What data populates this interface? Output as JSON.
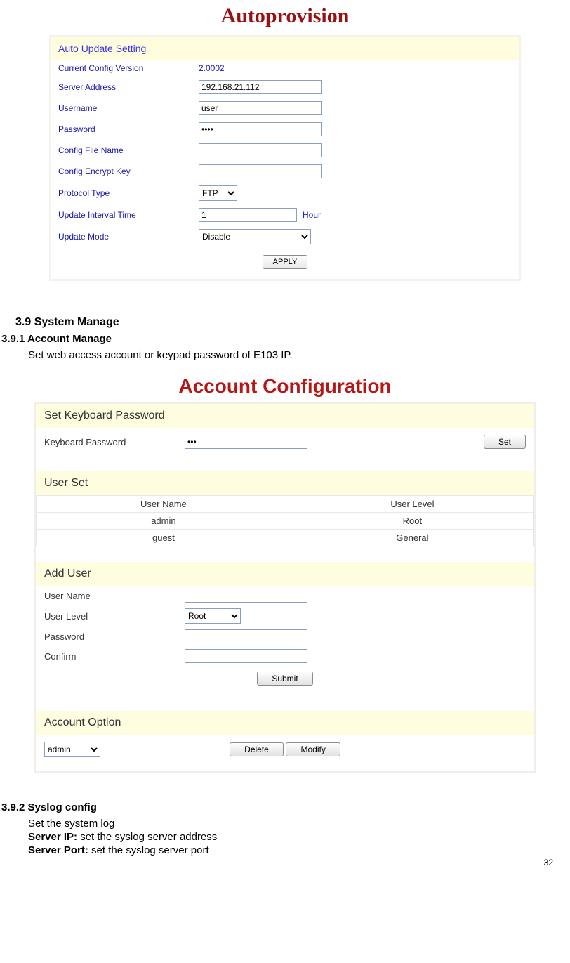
{
  "page_number": "32",
  "autoprovision": {
    "title": "Autoprovision",
    "section": "Auto Update Setting",
    "labels": {
      "current_config_version": "Current Config Version",
      "server_address": "Server Address",
      "username": "Username",
      "password": "Password",
      "config_file_name": "Config File Name",
      "config_encrypt_key": "Config Encrypt Key",
      "protocol_type": "Protocol Type",
      "update_interval_time": "Update Interval Time",
      "update_mode": "Update Mode"
    },
    "values": {
      "current_config_version": "2.0002",
      "server_address": "192.168.21.112",
      "username": "user",
      "password": "••••",
      "config_file_name": "",
      "config_encrypt_key": "",
      "protocol_type": "FTP",
      "update_interval_time": "1",
      "update_interval_unit": "Hour",
      "update_mode": "Disable"
    },
    "apply": "APPLY"
  },
  "doc": {
    "h39": "3.9 System Manage",
    "h391": "3.9.1 Account Manage",
    "p391": "Set web access account or keypad password of E103 IP.",
    "h392": "3.9.2 Syslog config",
    "p392a": "Set the system log",
    "p392b_label": "Server IP:",
    "p392b_text": " set the syslog server address",
    "p392c_label": "Server Port:",
    "p392c_text": " set the syslog server port"
  },
  "account_config": {
    "title": "Account Configuration",
    "sections": {
      "keyboard": "Set Keyboard Password",
      "user_set": "User Set",
      "add_user": "Add User",
      "account_option": "Account Option"
    },
    "keyboard": {
      "label": "Keyboard Password",
      "value": "•••",
      "set": "Set"
    },
    "user_set": {
      "headers": {
        "name": "User Name",
        "level": "User Level"
      },
      "rows": [
        {
          "name": "admin",
          "level": "Root"
        },
        {
          "name": "guest",
          "level": "General"
        }
      ]
    },
    "add_user": {
      "labels": {
        "user_name": "User Name",
        "user_level": "User Level",
        "password": "Password",
        "confirm": "Confirm"
      },
      "user_level_value": "Root",
      "submit": "Submit"
    },
    "account_option": {
      "selected": "admin",
      "delete": "Delete",
      "modify": "Modify"
    }
  }
}
